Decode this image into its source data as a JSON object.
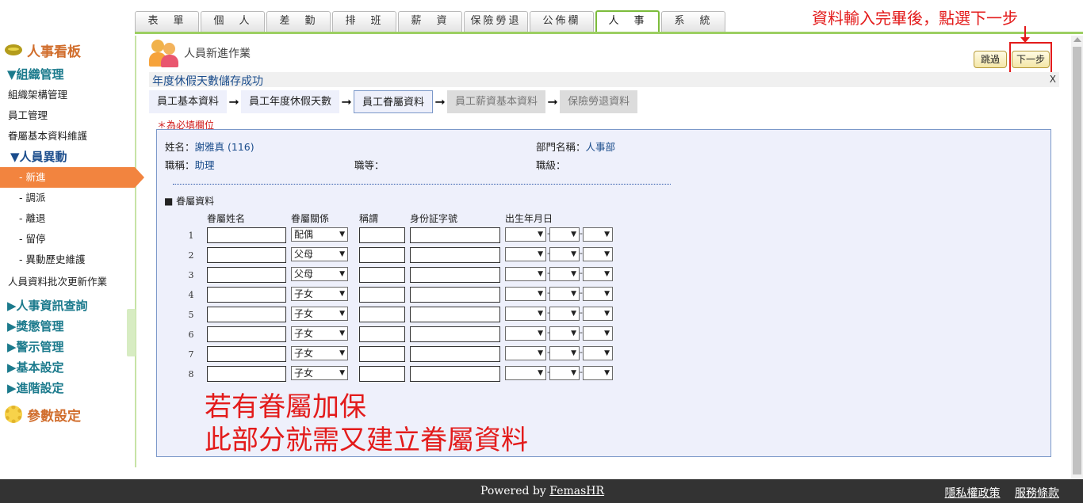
{
  "tabs": [
    "表　單",
    "個　人",
    "差　勤",
    "排　班",
    "薪　資",
    "保險勞退",
    "公佈欄",
    "人　事",
    "系　統"
  ],
  "active_tab_index": 7,
  "annotation_top": "資料輸入完畢後，點選下一步",
  "annotation_middle_line1": "若有眷屬加保",
  "annotation_middle_line2": "此部分就需又建立眷屬資料",
  "sidebar": {
    "title": "人事看板",
    "org_group": "▼組織管理",
    "org_items": [
      "組織架構管理",
      "員工管理",
      "眷屬基本資料維護"
    ],
    "personnel_group": "▼人員異動",
    "personnel_items": [
      "- 新進",
      "- 調派",
      "- 離退",
      "- 留停",
      "- 異動歷史維護"
    ],
    "batch_item": "人員資料批次更新作業",
    "collapsed_groups": [
      "▶人事資訊查詢",
      "▶獎懲管理",
      "▶警示管理",
      "▶基本設定",
      "▶進階設定"
    ],
    "params": "參數設定"
  },
  "page": {
    "title": "人員新進作業",
    "skip_label": "跳過",
    "next_label": "下一步",
    "message": "年度休假天數儲存成功",
    "close": "X",
    "steps": [
      "員工基本資料",
      "員工年度休假天數",
      "員工眷屬資料",
      "員工薪資基本資料",
      "保險勞退資料"
    ],
    "current_step_index": 2,
    "required_note": "＊為必填欄位"
  },
  "employee": {
    "name_label": "姓名：",
    "name_value": "謝雅真",
    "name_id": "(116)",
    "dept_label": "部門名稱：",
    "dept_value": "人事部",
    "title_label": "職稱：",
    "title_value": "助理",
    "grade_label": "職等：",
    "level_label": "職級："
  },
  "dependents": {
    "section": "■ 眷屬資料",
    "headers": [
      "眷屬姓名",
      "眷屬關係",
      "稱謂",
      "身份証字號",
      "出生年月日"
    ],
    "rows": [
      {
        "no": "1",
        "relation": "配偶"
      },
      {
        "no": "2",
        "relation": "父母"
      },
      {
        "no": "3",
        "relation": "父母"
      },
      {
        "no": "4",
        "relation": "子女"
      },
      {
        "no": "5",
        "relation": "子女"
      },
      {
        "no": "6",
        "relation": "子女"
      },
      {
        "no": "7",
        "relation": "子女"
      },
      {
        "no": "8",
        "relation": "子女"
      }
    ]
  },
  "footer": {
    "powered_prefix": "Powered by ",
    "powered_link": "FemasHR",
    "privacy": "隱私權政策",
    "terms": "服務條款"
  }
}
